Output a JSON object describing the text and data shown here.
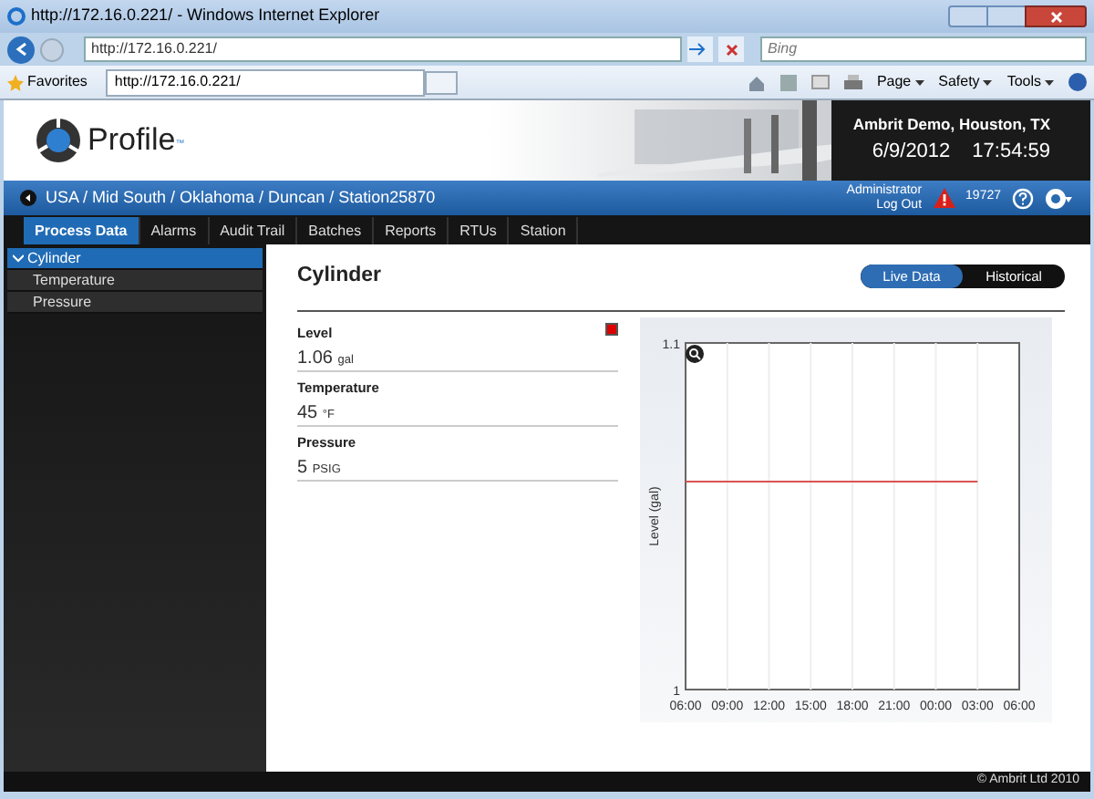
{
  "browser": {
    "title": "http://172.16.0.221/ - Windows Internet Explorer",
    "address": "http://172.16.0.221/",
    "search_placeholder": "Bing",
    "favorites": "Favorites",
    "tab": "http://172.16.0.221/",
    "menus": [
      "Page",
      "Safety",
      "Tools"
    ]
  },
  "header": {
    "logo": "Profile",
    "tm": "™",
    "site": "Ambrit Demo, Houston, TX",
    "date": "6/9/2012",
    "time": "17:54:59"
  },
  "breadcrumb": "USA / Mid South / Oklahoma / Duncan / Station25870",
  "user": {
    "name": "Administrator",
    "logout": "Log Out",
    "alarm_count": "19727"
  },
  "tabs": [
    {
      "label": "Process Data",
      "selected": true
    },
    {
      "label": "Alarms",
      "selected": false
    },
    {
      "label": "Audit Trail",
      "selected": false
    },
    {
      "label": "Batches",
      "selected": false
    },
    {
      "label": "Reports",
      "selected": false
    },
    {
      "label": "RTUs",
      "selected": false
    },
    {
      "label": "Station",
      "selected": false
    }
  ],
  "sidebar": {
    "items": [
      {
        "label": "Cylinder",
        "expanded": true,
        "selected": true,
        "children": [
          {
            "label": "Temperature",
            "selected": false
          },
          {
            "label": "Pressure",
            "selected": false
          }
        ]
      }
    ]
  },
  "title": "Cylinder",
  "view_toggle": [
    {
      "label": "Live Data",
      "selected": true
    },
    {
      "label": "Historical",
      "selected": false
    }
  ],
  "readings": [
    {
      "name": "Level",
      "value": "1.06",
      "unit": "gal",
      "flagged": true
    },
    {
      "name": "Temperature",
      "value": "45",
      "unit": "°F",
      "flagged": false
    },
    {
      "name": "Pressure",
      "value": "5",
      "unit": "PSIG",
      "flagged": false
    }
  ],
  "chart_data": {
    "type": "line",
    "ylabel": "Level (gal)",
    "x": [
      "06:00",
      "09:00",
      "12:00",
      "15:00",
      "18:00",
      "21:00",
      "00:00",
      "03:00",
      "06:00"
    ],
    "grid": true,
    "series": [
      {
        "color": "#d9534f",
        "values": [
          1.06,
          1.06,
          1.06,
          1.06,
          1.06,
          1.06,
          1.06,
          1.06,
          null
        ]
      }
    ],
    "ylim": [
      1,
      1.1
    ],
    "yticks": [
      1,
      1.1
    ]
  },
  "footer": "© Ambrit Ltd 2010"
}
